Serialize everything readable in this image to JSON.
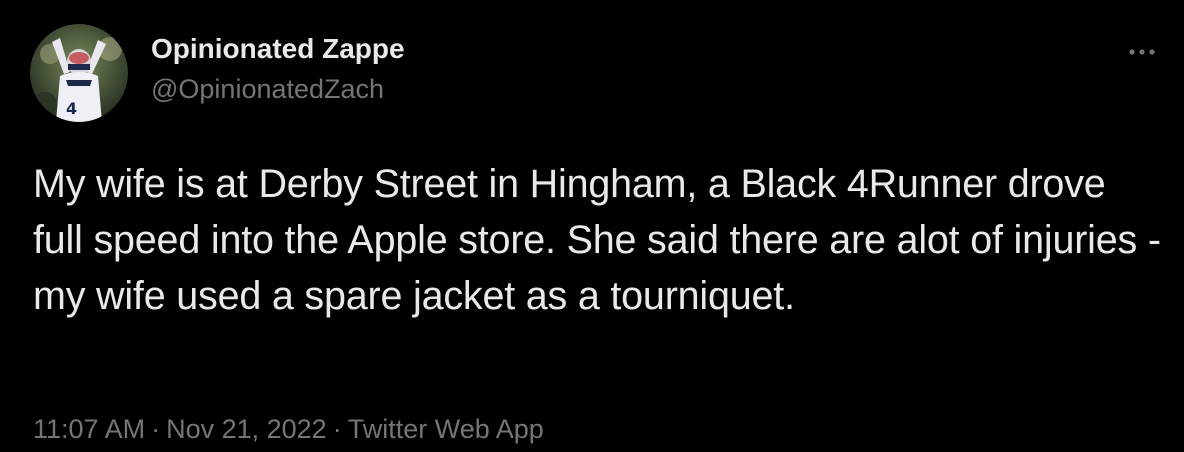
{
  "author": {
    "display_name": "Opinionated Zappe",
    "handle": "@OpinionatedZach"
  },
  "tweet": {
    "text": "My wife is at Derby Street in Hingham, a Black 4Runner drove full speed into the Apple store. She said there are alot of injuries - my wife used a spare jacket as a tourniquet.",
    "time": "11:07 AM",
    "date": "Nov 21, 2022",
    "source": "Twitter Web App",
    "separator": "·"
  },
  "icons": {
    "more": "more-horizontal-icon",
    "avatar": "avatar-photo"
  },
  "colors": {
    "background": "#000000",
    "primary_text": "#e7e9ea",
    "secondary_text": "#71767b"
  }
}
